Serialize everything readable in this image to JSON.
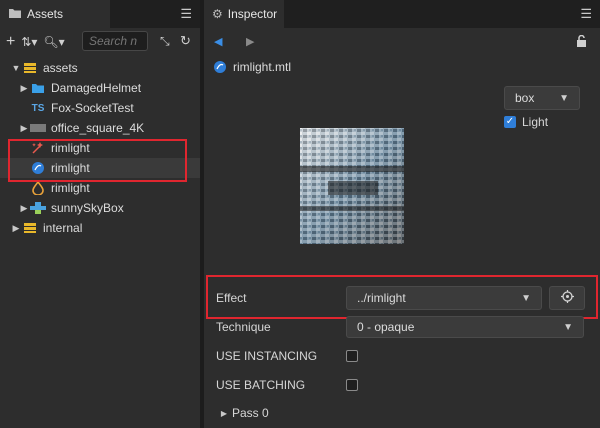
{
  "assets_panel": {
    "tab_label": "Assets",
    "search_placeholder": "Search n",
    "tree": [
      {
        "label": "assets",
        "level": 0,
        "expanded": true,
        "icon": "database-icon"
      },
      {
        "label": "DamagedHelmet",
        "level": 1,
        "icon": "folder-icon"
      },
      {
        "label": "Fox-SocketTest",
        "level": 1,
        "icon": "typescript-icon",
        "icon_text": "TS"
      },
      {
        "label": "office_square_4K",
        "level": 1,
        "icon": "image-icon"
      },
      {
        "label": "rimlight",
        "level": 1,
        "icon": "effect-icon"
      },
      {
        "label": "rimlight",
        "level": 1,
        "icon": "material-icon",
        "selected": true
      },
      {
        "label": "rimlight",
        "level": 1,
        "icon": "shader-icon"
      },
      {
        "label": "sunnySkyBox",
        "level": 1,
        "icon": "skybox-icon"
      },
      {
        "label": "internal",
        "level": 0,
        "icon": "database-icon"
      }
    ]
  },
  "inspector_panel": {
    "tab_label": "Inspector",
    "file_name": "rimlight.mtl",
    "preview_shape": "box",
    "light_label": "Light",
    "light_checked": true,
    "effect_label": "Effect",
    "effect_value": "../rimlight",
    "technique_label": "Technique",
    "technique_value": "0 - opaque",
    "use_instancing_label": "USE INSTANCING",
    "use_batching_label": "USE BATCHING",
    "pass_label": "Pass 0"
  },
  "colors": {
    "highlight_box": "#e0262f",
    "accent_blue": "#2f7ed8"
  }
}
